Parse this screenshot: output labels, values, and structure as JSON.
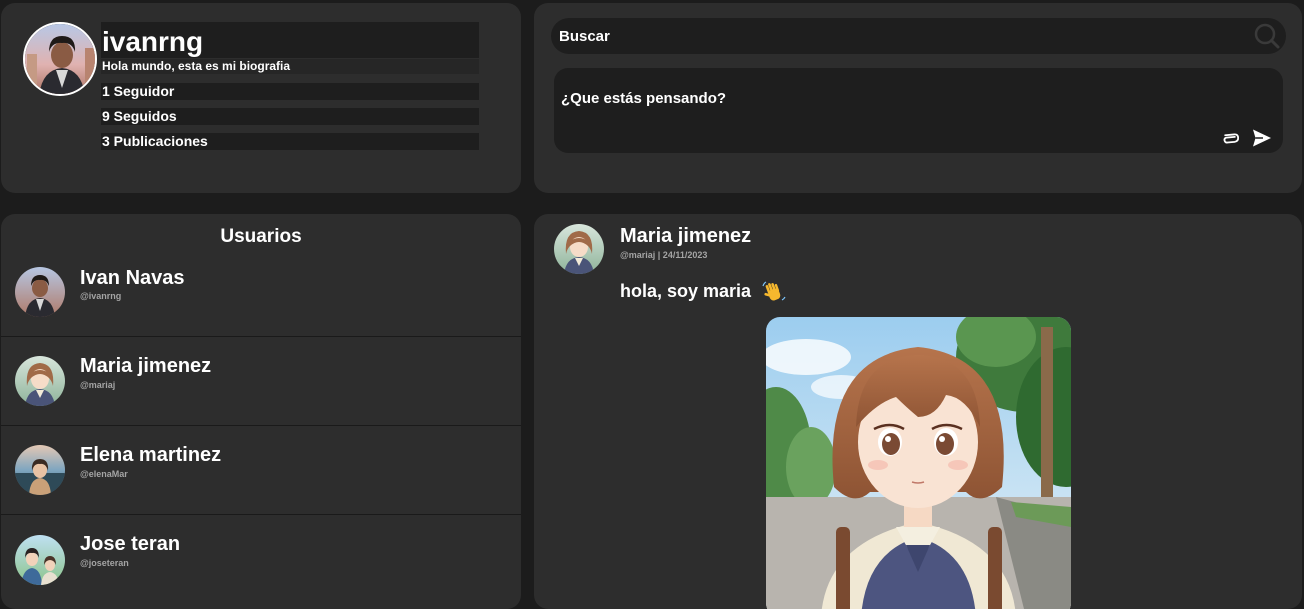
{
  "profile": {
    "username": "ivanrng",
    "bio": "Hola mundo, esta es mi biografia",
    "followers": "1 Seguidor",
    "following": "9 Seguidos",
    "posts": "3 Publicaciones"
  },
  "search": {
    "placeholder": "Buscar"
  },
  "composer": {
    "placeholder": "¿Que estás pensando?"
  },
  "users": {
    "title": "Usuarios",
    "items": [
      {
        "name": "Ivan Navas",
        "handle": "@ivanrng"
      },
      {
        "name": "Maria jimenez",
        "handle": "@mariaj"
      },
      {
        "name": "Elena martinez",
        "handle": "@elenaMar"
      },
      {
        "name": "Jose teran",
        "handle": "@joseteran"
      }
    ]
  },
  "post": {
    "author": "Maria jimenez",
    "meta": "@mariaj | 24/11/2023",
    "text": "hola, soy maria",
    "emoji_icon": "waving-hand-icon"
  },
  "colors": {
    "background": "#1c1c1c",
    "panel": "#2d2d2d",
    "field": "#1e1e1e",
    "text": "#ffffff",
    "muted": "#a4a4a4"
  }
}
